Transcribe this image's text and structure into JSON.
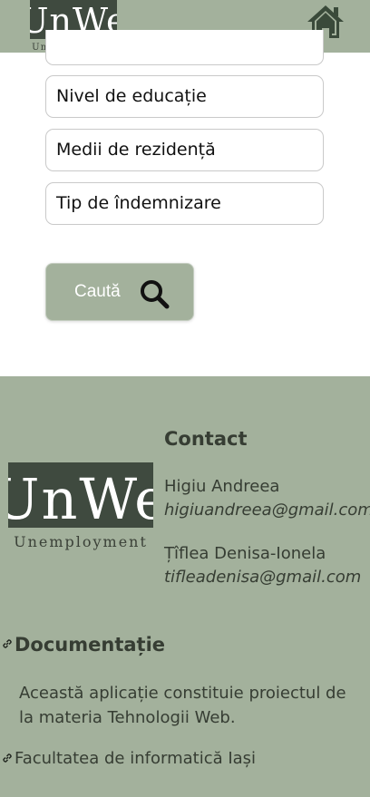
{
  "header": {
    "logo": {
      "main": "UnWe",
      "sub": "Unemployment"
    },
    "home_icon": "home-icon"
  },
  "filters": {
    "partial_field": "",
    "education_label": "Nivel de educație",
    "residence_label": "Medii de rezidență",
    "allowance_label": "Tip de îndemnizare"
  },
  "search_button": {
    "label": "Caută",
    "icon": "search-icon"
  },
  "footer": {
    "logo": {
      "main": "UnWe",
      "sub": "Unemployment"
    },
    "contact_title": "Contact",
    "contacts": [
      {
        "name": "Higiu Andreea",
        "email": "higiuandreea@gmail.com"
      },
      {
        "name": "Țîflea Denisa-Ionela",
        "email": "tifleadenisa@gmail.com"
      }
    ],
    "documentation_title": "Documentație",
    "description": "Această aplicație constituie proiectul de la materia Tehnologii Web.",
    "faculty_link": "Facultatea de informatică Iași"
  },
  "colors": {
    "sage": "#a3b19c",
    "dark_text": "#363d33"
  }
}
